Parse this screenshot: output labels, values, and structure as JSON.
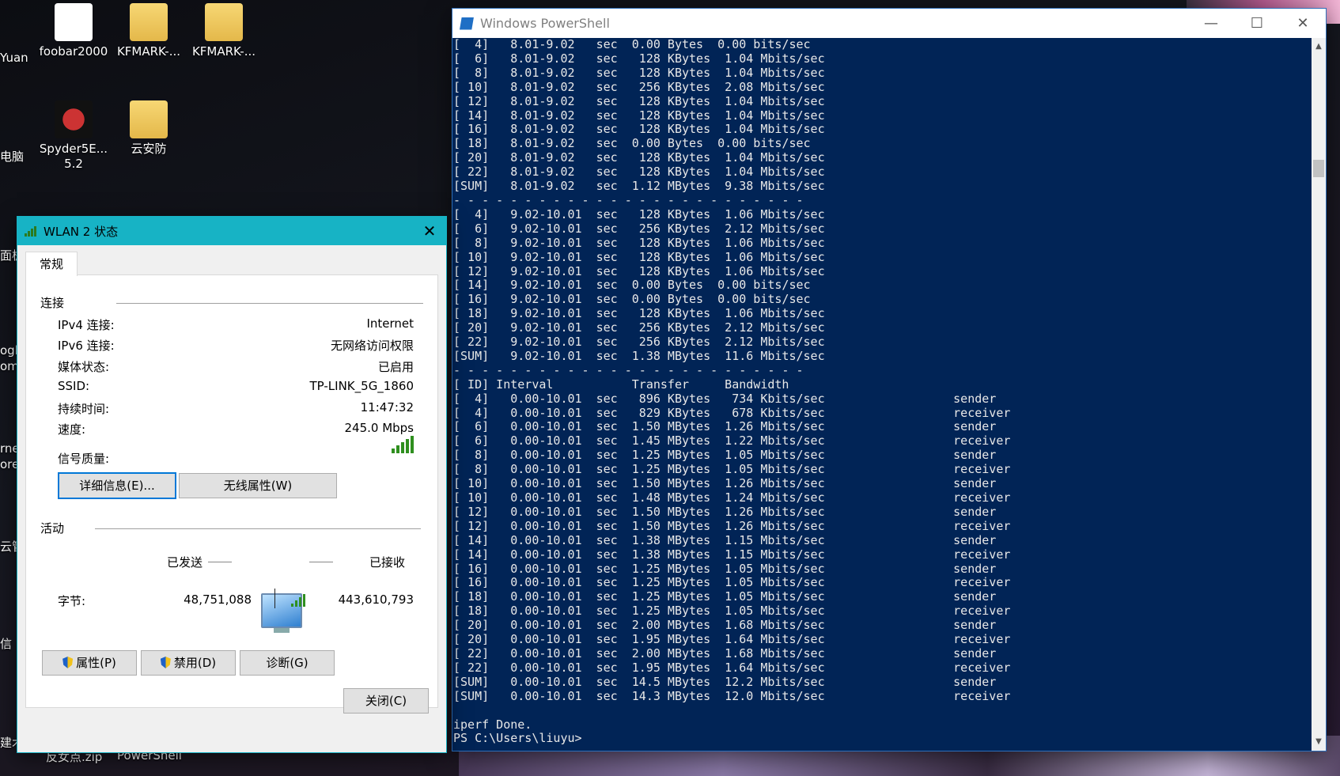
{
  "desktop": {
    "icons": [
      {
        "label": "foobar2000"
      },
      {
        "label": "KFMARK-..."
      },
      {
        "label": "KFMARK-..."
      },
      {
        "label": "Spyder5E... 5.2"
      },
      {
        "label": "云安防"
      }
    ],
    "partial_labels": [
      "Yuan",
      "电脑",
      "面板",
      "ogle",
      "ome",
      "rne",
      "ore",
      "云管",
      "信",
      "建术"
    ],
    "taskbar_labels": [
      "反女点.zip",
      "PowerShell"
    ]
  },
  "powershell": {
    "title": "Windows PowerShell",
    "controls": {
      "minimize": "—",
      "maximize": "☐",
      "close": "✕"
    },
    "lines": [
      "[  4]   8.01-9.02   sec  0.00 Bytes  0.00 bits/sec",
      "[  6]   8.01-9.02   sec   128 KBytes  1.04 Mbits/sec",
      "[  8]   8.01-9.02   sec   128 KBytes  1.04 Mbits/sec",
      "[ 10]   8.01-9.02   sec   256 KBytes  2.08 Mbits/sec",
      "[ 12]   8.01-9.02   sec   128 KBytes  1.04 Mbits/sec",
      "[ 14]   8.01-9.02   sec   128 KBytes  1.04 Mbits/sec",
      "[ 16]   8.01-9.02   sec   128 KBytes  1.04 Mbits/sec",
      "[ 18]   8.01-9.02   sec  0.00 Bytes  0.00 bits/sec",
      "[ 20]   8.01-9.02   sec   128 KBytes  1.04 Mbits/sec",
      "[ 22]   8.01-9.02   sec   128 KBytes  1.04 Mbits/sec",
      "[SUM]   8.01-9.02   sec  1.12 MBytes  9.38 Mbits/sec",
      "- - - - - - - - - - - - - - - - - - - - - - - - -",
      "[  4]   9.02-10.01  sec   128 KBytes  1.06 Mbits/sec",
      "[  6]   9.02-10.01  sec   256 KBytes  2.12 Mbits/sec",
      "[  8]   9.02-10.01  sec   128 KBytes  1.06 Mbits/sec",
      "[ 10]   9.02-10.01  sec   128 KBytes  1.06 Mbits/sec",
      "[ 12]   9.02-10.01  sec   128 KBytes  1.06 Mbits/sec",
      "[ 14]   9.02-10.01  sec  0.00 Bytes  0.00 bits/sec",
      "[ 16]   9.02-10.01  sec  0.00 Bytes  0.00 bits/sec",
      "[ 18]   9.02-10.01  sec   128 KBytes  1.06 Mbits/sec",
      "[ 20]   9.02-10.01  sec   256 KBytes  2.12 Mbits/sec",
      "[ 22]   9.02-10.01  sec   256 KBytes  2.12 Mbits/sec",
      "[SUM]   9.02-10.01  sec  1.38 MBytes  11.6 Mbits/sec",
      "- - - - - - - - - - - - - - - - - - - - - - - - -",
      "[ ID] Interval           Transfer     Bandwidth",
      "[  4]   0.00-10.01  sec   896 KBytes   734 Kbits/sec                  sender",
      "[  4]   0.00-10.01  sec   829 KBytes   678 Kbits/sec                  receiver",
      "[  6]   0.00-10.01  sec  1.50 MBytes  1.26 Mbits/sec                  sender",
      "[  6]   0.00-10.01  sec  1.45 MBytes  1.22 Mbits/sec                  receiver",
      "[  8]   0.00-10.01  sec  1.25 MBytes  1.05 Mbits/sec                  sender",
      "[  8]   0.00-10.01  sec  1.25 MBytes  1.05 Mbits/sec                  receiver",
      "[ 10]   0.00-10.01  sec  1.50 MBytes  1.26 Mbits/sec                  sender",
      "[ 10]   0.00-10.01  sec  1.48 MBytes  1.24 Mbits/sec                  receiver",
      "[ 12]   0.00-10.01  sec  1.50 MBytes  1.26 Mbits/sec                  sender",
      "[ 12]   0.00-10.01  sec  1.50 MBytes  1.26 Mbits/sec                  receiver",
      "[ 14]   0.00-10.01  sec  1.38 MBytes  1.15 Mbits/sec                  sender",
      "[ 14]   0.00-10.01  sec  1.38 MBytes  1.15 Mbits/sec                  receiver",
      "[ 16]   0.00-10.01  sec  1.25 MBytes  1.05 Mbits/sec                  sender",
      "[ 16]   0.00-10.01  sec  1.25 MBytes  1.05 Mbits/sec                  receiver",
      "[ 18]   0.00-10.01  sec  1.25 MBytes  1.05 Mbits/sec                  sender",
      "[ 18]   0.00-10.01  sec  1.25 MBytes  1.05 Mbits/sec                  receiver",
      "[ 20]   0.00-10.01  sec  2.00 MBytes  1.68 Mbits/sec                  sender",
      "[ 20]   0.00-10.01  sec  1.95 MBytes  1.64 Mbits/sec                  receiver",
      "[ 22]   0.00-10.01  sec  2.00 MBytes  1.68 Mbits/sec                  sender",
      "[ 22]   0.00-10.01  sec  1.95 MBytes  1.64 Mbits/sec                  receiver",
      "[SUM]   0.00-10.01  sec  14.5 MBytes  12.2 Mbits/sec                  sender",
      "[SUM]   0.00-10.01  sec  14.3 MBytes  12.0 Mbits/sec                  receiver",
      "",
      "iperf Done.",
      "PS C:\\Users\\liuyu>"
    ]
  },
  "wlan": {
    "title": "WLAN 2 状态",
    "close": "✕",
    "tab": "常规",
    "connection": {
      "header": "连接",
      "rows": [
        {
          "label": "IPv4 连接:",
          "value": "Internet"
        },
        {
          "label": "IPv6 连接:",
          "value": "无网络访问权限"
        },
        {
          "label": "媒体状态:",
          "value": "已启用"
        },
        {
          "label": "SSID:",
          "value": "TP-LINK_5G_1860"
        },
        {
          "label": "持续时间:",
          "value": "11:47:32"
        },
        {
          "label": "速度:",
          "value": "245.0 Mbps"
        }
      ],
      "signal_label": "信号质量:",
      "signal_bars": 5
    },
    "buttons": {
      "details": "详细信息(E)...",
      "wireless": "无线属性(W)"
    },
    "activity": {
      "header": "活动",
      "sent_label": "已发送",
      "received_label": "已接收",
      "bytes_label": "字节:",
      "bytes_sent": "48,751,088",
      "bytes_received": "443,610,793"
    },
    "actions": {
      "properties": "属性(P)",
      "disable": "禁用(D)",
      "diagnose": "诊断(G)"
    },
    "close_button": "关闭(C)"
  }
}
